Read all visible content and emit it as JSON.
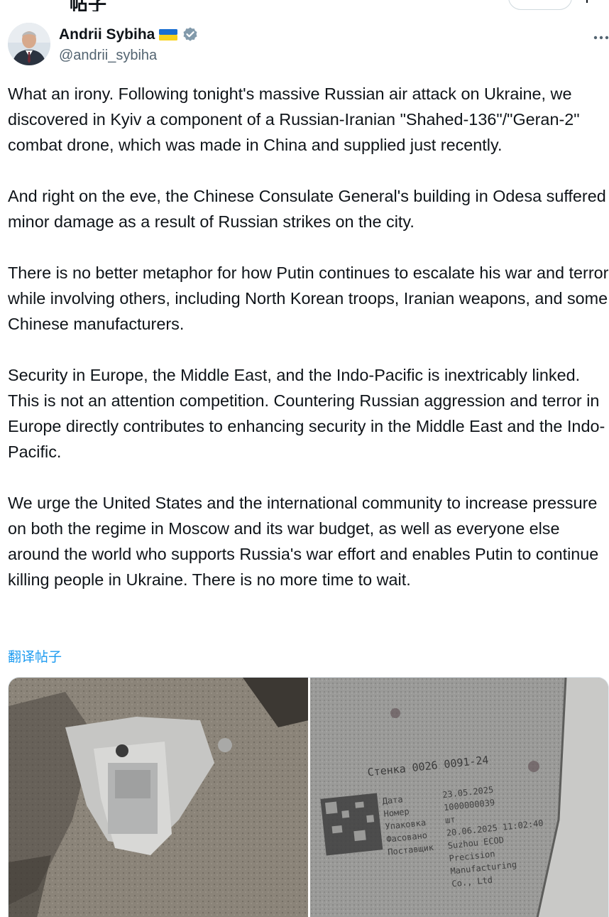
{
  "author": {
    "name": "Andrii Sybiha",
    "handle": "@andrii_sybiha",
    "flag_colors": [
      "#1a6fd1",
      "#f8d21c"
    ],
    "verified_color": "#829aab"
  },
  "tweet": {
    "paragraphs": [
      "What an irony. Following tonight's massive Russian air attack on Ukraine, we discovered in Kyiv a component of a Russian-Iranian \"Shahed-136\"/\"Geran-2\" combat drone, which was made in China and supplied just recently.",
      "And right on the eve, the Chinese Consulate General's building in Odesa suffered minor damage as a result of Russian strikes on the city.",
      "There is no better metaphor for how Putin continues to escalate his war and terror while involving others, including North Korean troops, Iranian weapons, and some Chinese manufacturers.",
      "Security in Europe, the Middle East, and the Indo-Pacific is inextricably linked. This is not an attention competition. Countering Russian aggression and terror in Europe directly contributes to enhancing security in the Middle East and the Indo-Pacific.",
      "We urge the United States and the international community to increase pressure on both the regime in Moscow and its war budget, as well as everyone else around the world who supports Russia's war effort and enables Putin to continue killing people in Ukraine. There is no more time to wait."
    ],
    "translate_label": "翻译帖子"
  },
  "media": {
    "photo_right_label": {
      "line1": "Стенка 0026 0091-24",
      "fields": [
        "Дата",
        "Номер",
        "Упаковка",
        "Фасовано",
        "Поставщик"
      ],
      "values": [
        "23.05.2025",
        "1000000039",
        "шт",
        "20.06.2025 11:02:40",
        "Suzhou ECOD"
      ],
      "extra": [
        "Precision",
        "Manufacturing",
        "Co., Ltd"
      ]
    }
  },
  "colors": {
    "accent": "#1d9bf0",
    "text": "#0f1419",
    "secondary": "#536471"
  }
}
